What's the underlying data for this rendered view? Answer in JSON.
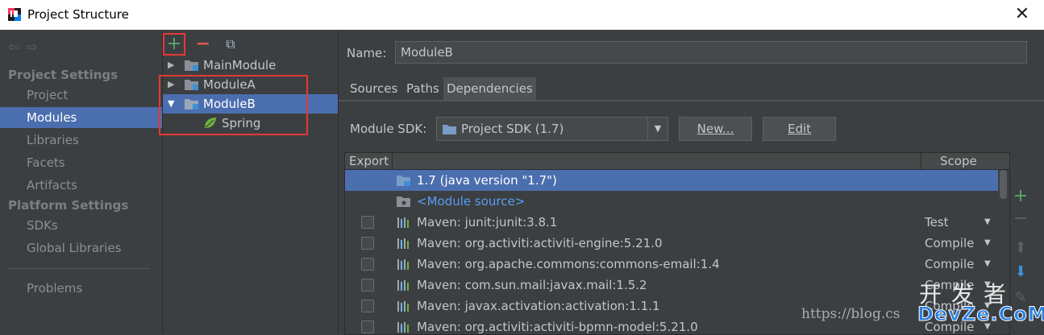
{
  "window": {
    "title": "Project Structure"
  },
  "nav": {
    "sections": [
      {
        "label": "Project Settings",
        "items": [
          "Project",
          "Modules",
          "Libraries",
          "Facets",
          "Artifacts"
        ]
      },
      {
        "label": "Platform Settings",
        "items": [
          "SDKs",
          "Global Libraries"
        ]
      }
    ],
    "problems": "Problems",
    "active_item": "Modules"
  },
  "tree": {
    "toolbar": {
      "add": "+",
      "remove": "−",
      "copy": "⧉"
    },
    "nodes": [
      {
        "label": "MainModule",
        "expanded": false
      },
      {
        "label": "ModuleA",
        "expanded": false
      },
      {
        "label": "ModuleB",
        "expanded": true,
        "selected": true
      },
      {
        "label": "Spring"
      }
    ]
  },
  "main": {
    "name_label": "Name:",
    "name_value": "ModuleB",
    "tabs": [
      "Sources",
      "Paths",
      "Dependencies"
    ],
    "active_tab": "Dependencies",
    "sdk_label": "Module SDK:",
    "sdk_value": "Project SDK (1.7)",
    "new_button": "New...",
    "edit_button": "Edit",
    "table": {
      "headers": {
        "export": "Export",
        "scope": "Scope"
      },
      "rows": [
        {
          "text": "1.7 (java version \"1.7\")",
          "scope": "",
          "checkbox": false,
          "selected": true
        },
        {
          "text": "<Module source>",
          "scope": "",
          "checkbox": false,
          "link": true
        },
        {
          "text": "Maven: junit:junit:3.8.1",
          "scope": "Test",
          "checkbox": true
        },
        {
          "text": "Maven: org.activiti:activiti-engine:5.21.0",
          "scope": "Compile",
          "checkbox": true
        },
        {
          "text": "Maven: org.apache.commons:commons-email:1.4",
          "scope": "Compile",
          "checkbox": true
        },
        {
          "text": "Maven: com.sun.mail:javax.mail:1.5.2",
          "scope": "Compile",
          "checkbox": true
        },
        {
          "text": "Maven: javax.activation:activation:1.1.1",
          "scope": "Compile",
          "checkbox": true
        },
        {
          "text": "Maven: org.activiti:activiti-bpmn-model:5.21.0",
          "scope": "Compile",
          "checkbox": true
        }
      ]
    }
  },
  "watermark": {
    "url": "https://blog.cs",
    "logo_cn": "开发者",
    "logo_en": "DevZe.CoM"
  },
  "colors": {
    "selection": "#4b6eaf",
    "background": "#3c3f41",
    "link": "#589df6",
    "highlight": "#e53935"
  }
}
